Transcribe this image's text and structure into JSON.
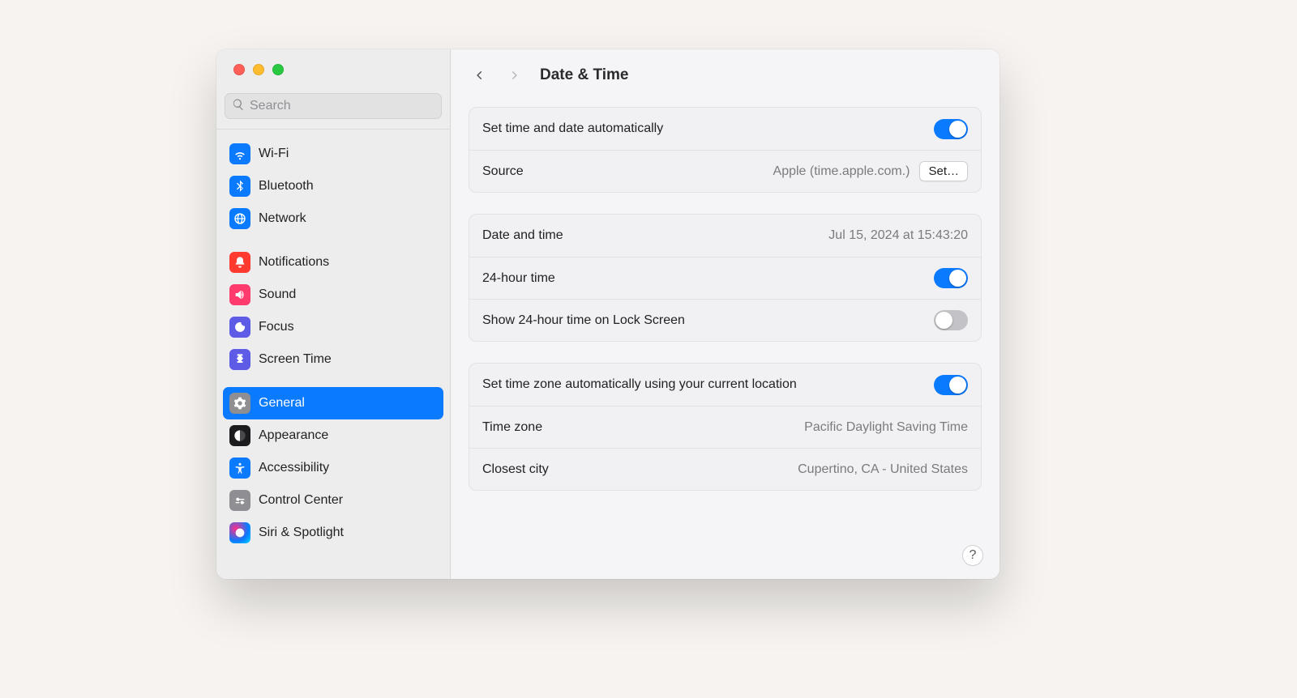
{
  "header": {
    "title": "Date & Time"
  },
  "search": {
    "placeholder": "Search",
    "value": ""
  },
  "sidebar": {
    "groups": [
      [
        {
          "id": "wifi",
          "label": "Wi-Fi",
          "icon": "wifi"
        },
        {
          "id": "bluetooth",
          "label": "Bluetooth",
          "icon": "bt"
        },
        {
          "id": "network",
          "label": "Network",
          "icon": "net"
        }
      ],
      [
        {
          "id": "notifications",
          "label": "Notifications",
          "icon": "notif"
        },
        {
          "id": "sound",
          "label": "Sound",
          "icon": "sound"
        },
        {
          "id": "focus",
          "label": "Focus",
          "icon": "focus"
        },
        {
          "id": "screentime",
          "label": "Screen Time",
          "icon": "screentime"
        }
      ],
      [
        {
          "id": "general",
          "label": "General",
          "icon": "general",
          "selected": true
        },
        {
          "id": "appearance",
          "label": "Appearance",
          "icon": "appearance"
        },
        {
          "id": "accessibility",
          "label": "Accessibility",
          "icon": "accessibility"
        },
        {
          "id": "controlcenter",
          "label": "Control Center",
          "icon": "cc"
        },
        {
          "id": "siri",
          "label": "Siri & Spotlight",
          "icon": "siri"
        }
      ]
    ]
  },
  "settings": {
    "auto_time": {
      "label": "Set time and date automatically",
      "enabled": true
    },
    "source": {
      "label": "Source",
      "value": "Apple (time.apple.com.)",
      "button": "Set…"
    },
    "datetime": {
      "label": "Date and time",
      "value": "Jul 15, 2024 at 15:43:20"
    },
    "twenty_four_hour": {
      "label": "24-hour time",
      "enabled": true
    },
    "lock_24h": {
      "label": "Show 24-hour time on Lock Screen",
      "enabled": false
    },
    "auto_tz": {
      "label": "Set time zone automatically using your current location",
      "enabled": true
    },
    "timezone": {
      "label": "Time zone",
      "value": "Pacific Daylight Saving Time"
    },
    "closest_city": {
      "label": "Closest city",
      "value": "Cupertino, CA - United States"
    }
  },
  "help_label": "?"
}
